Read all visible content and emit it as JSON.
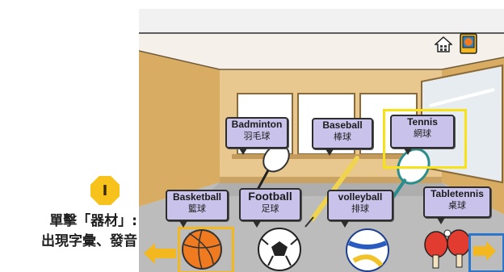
{
  "instruction": {
    "step_number": "I",
    "line1": "單擊「器材」:",
    "line2": "出現字彙、發音"
  },
  "toolbar": {
    "home_icon": "home-icon",
    "book_icon": "book-icon"
  },
  "items": [
    {
      "en": "Badminton",
      "zh": "羽毛球"
    },
    {
      "en": "Baseball",
      "zh": "棒球"
    },
    {
      "en": "Tennis",
      "zh": "網球"
    },
    {
      "en": "Basketball",
      "zh": "籃球"
    },
    {
      "en": "Football",
      "zh": "足球"
    },
    {
      "en": "volleyball",
      "zh": "排球"
    },
    {
      "en": "Tabletennis",
      "zh": "桌球"
    }
  ],
  "colors": {
    "bubble": "#c9c2ea",
    "highlight_yellow": "#f7e21a",
    "highlight_orange": "#f3b81f",
    "highlight_blue": "#2e76c9",
    "nav_arrow": "#f3b81f"
  }
}
